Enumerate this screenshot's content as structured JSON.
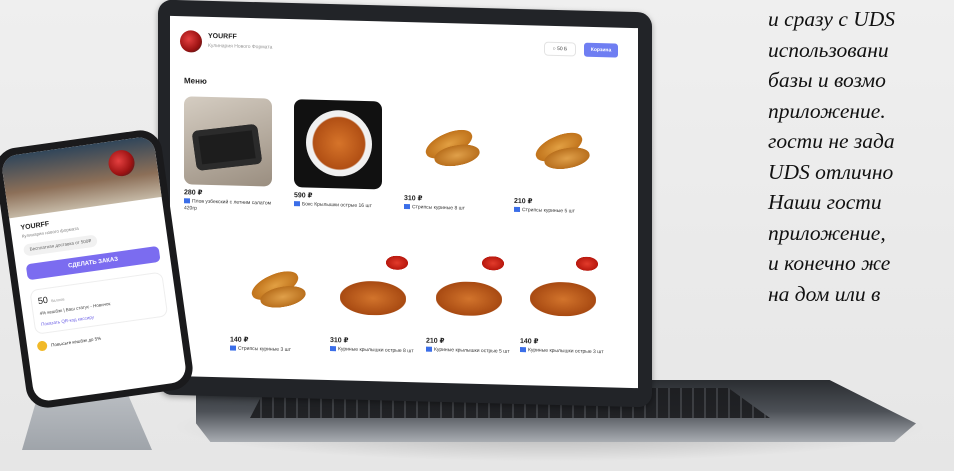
{
  "side_text": {
    "lines": [
      "и сразу с UDS",
      "использовани",
      "базы и возмо",
      "приложение.",
      "гости не зада",
      "UDS отлично",
      "Наши гости",
      "приложение,",
      "и конечно же",
      "на дом или в"
    ]
  },
  "laptop": {
    "header": {
      "brand": "YOURFF",
      "subtitle": "Кулинария Нового Формата",
      "bonus": "○ 50 Б",
      "cart_label": "Корзина"
    },
    "menu_title": "Меню",
    "items": [
      {
        "price": "280 ₽",
        "name": "Плов узбекский с летним салатом 420гр",
        "icon": "pilaf-box-photo"
      },
      {
        "price": "590 ₽",
        "name": "Бокс Крылышки острые 16 шт",
        "icon": "wings-bowl-photo"
      },
      {
        "price": "310 ₽",
        "name": "Стрипсы куриные 8 шт",
        "icon": "strips-photo"
      },
      {
        "price": "210 ₽",
        "name": "Стрипсы куриные 5 шт",
        "icon": "strips-photo"
      },
      {
        "price": "140 ₽",
        "name": "Стрипсы куриные 3 шт",
        "icon": "strips-photo"
      },
      {
        "price": "310 ₽",
        "name": "Куриные крылышки острые 8 шт",
        "icon": "wings-photo"
      },
      {
        "price": "210 ₽",
        "name": "Куриные крылышки острые 5 шт",
        "icon": "wings-photo"
      },
      {
        "price": "140 ₽",
        "name": "Куриные крылышки острые 3 шт",
        "icon": "wings-photo"
      }
    ]
  },
  "phone": {
    "brand": "YOURFF",
    "subtitle": "Кулинария нового формата",
    "chip": "Бесплатная доставка от 500₽",
    "order_button": "СДЕЛАТЬ ЗАКАЗ",
    "points": "50",
    "points_unit": "баллов",
    "cashback_line": "4% кешбэк | Ваш статус - Новичок",
    "qr_link": "Показать QR-код кассиру",
    "footer": "Повысьте кешбэк до 5%"
  },
  "colors": {
    "accent": "#6f7ef2",
    "phone_button": "#7b6cf0"
  }
}
